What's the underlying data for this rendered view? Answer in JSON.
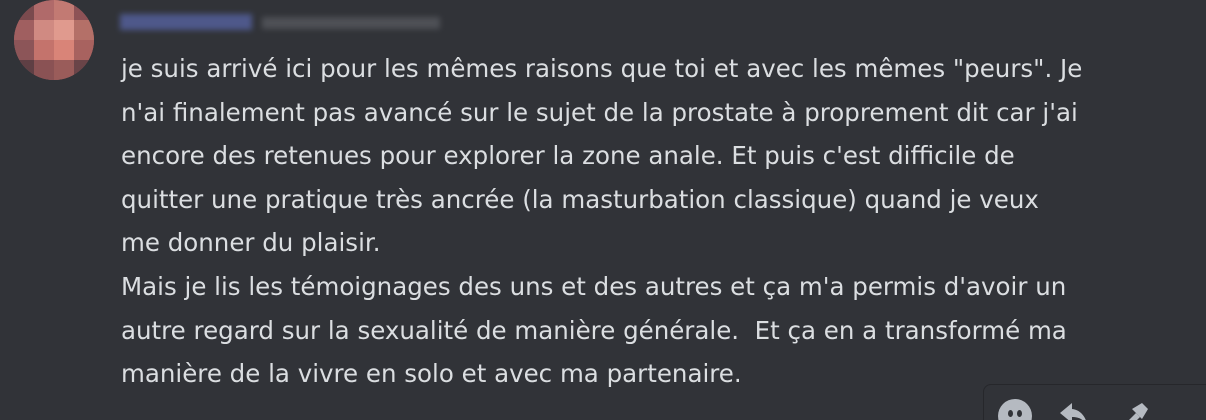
{
  "message": {
    "lines": [
      "je suis arrivé ici pour les mêmes raisons que toi et avec les mêmes \"peurs\". Je",
      "n'ai finalement pas avancé sur le sujet de la prostate à proprement dit car j'ai",
      "encore des retenues pour explorer la zone anale. Et puis c'est difficile de",
      "quitter une pratique très ancrée (la masturbation classique) quand je veux",
      "me donner du plaisir.",
      "Mais je lis les témoignages des uns et des autres et ça m'a permis d'avoir un",
      "autre regard sur la sexualité de manière générale.  Et ça en a transformé ma",
      "manière de la vivre en solo et avec ma partenaire."
    ]
  },
  "toolbar": {
    "icons": [
      "add-reaction-icon",
      "reply-icon",
      "forward-icon"
    ]
  },
  "colors": {
    "background": "#313338",
    "text": "#dbdee1",
    "icon": "#b5bac1"
  }
}
